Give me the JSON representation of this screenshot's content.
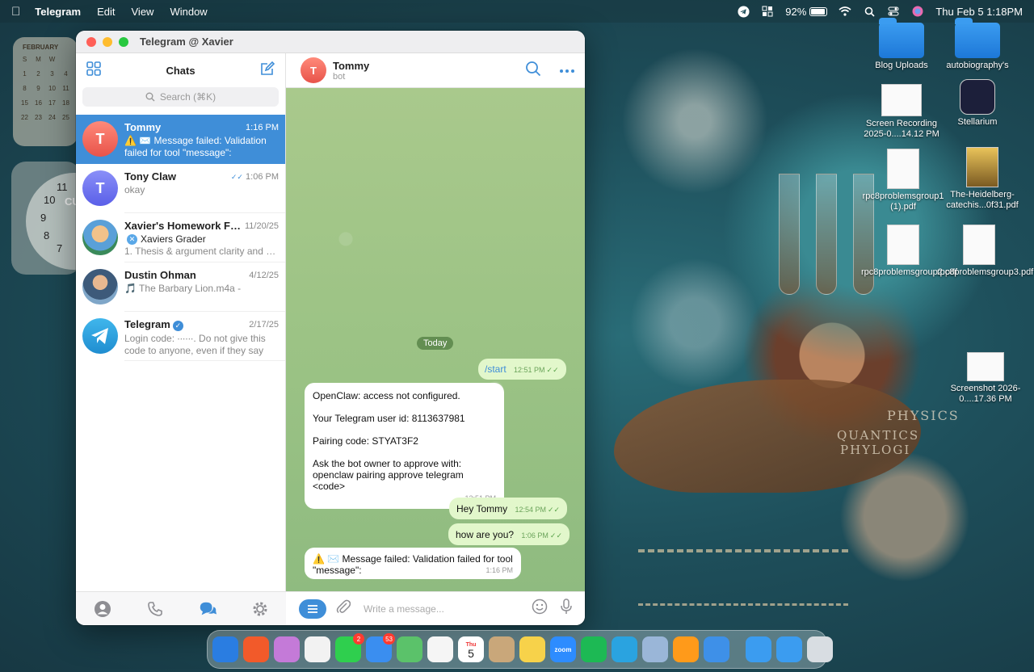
{
  "menubar": {
    "app_name": "Telegram",
    "items": [
      "Edit",
      "View",
      "Window"
    ],
    "battery": "92%",
    "datetime": "Thu Feb 5  1:18PM"
  },
  "calendar_widget": {
    "month": "FEBRUARY",
    "days": [
      "S",
      "M",
      "W",
      "",
      "1",
      "2",
      "3",
      "4",
      "8",
      "9",
      "10",
      "11",
      "15",
      "16",
      "17",
      "18",
      "22",
      "23",
      "24",
      "25"
    ]
  },
  "clock_widget": {
    "numbers": [
      "11",
      "10",
      "9",
      "8",
      "7",
      "6"
    ],
    "label": "CU"
  },
  "desktop": {
    "words": [
      "PHYSICS",
      "QUANTICS",
      "PHYLOGI"
    ],
    "icons": [
      {
        "label": "Blog Uploads",
        "type": "folder"
      },
      {
        "label": "autobiography's",
        "type": "folder"
      },
      {
        "label": "Screen Recording 2025-0....14.12 PM",
        "type": "doc"
      },
      {
        "label": "Stellarium",
        "type": "dark"
      },
      {
        "label": "rpc8problemsgroup1 (1).pdf",
        "type": "doc"
      },
      {
        "label": "The-Heidelberg-catechis...0f31.pdf",
        "type": "book"
      },
      {
        "label": "rpc8problemsgroup2.pdf",
        "type": "doc"
      },
      {
        "label": "rpc8problemsgroup3.pdf",
        "type": "doc"
      },
      {
        "label": "Screenshot 2026-0....17.36 PM",
        "type": "doc"
      }
    ]
  },
  "dock": {
    "apps": [
      {
        "name": "Finder",
        "color": "#2a7de1",
        "badge": ""
      },
      {
        "name": "Brave",
        "color": "#f25a2a",
        "badge": ""
      },
      {
        "name": "Launchpad",
        "color": "#c47ad8",
        "badge": ""
      },
      {
        "name": "ChatGPT",
        "color": "#f2f2f2",
        "badge": ""
      },
      {
        "name": "Messages",
        "color": "#2fcf4e",
        "badge": "2"
      },
      {
        "name": "Mail",
        "color": "#3a8ef0",
        "badge": "53"
      },
      {
        "name": "Maps",
        "color": "#5bc26a",
        "badge": ""
      },
      {
        "name": "Photos",
        "color": "#f5f5f5",
        "badge": ""
      },
      {
        "name": "Calendar",
        "color": "#ffffff",
        "badge": ""
      },
      {
        "name": "Contacts",
        "color": "#c9a77a",
        "badge": ""
      },
      {
        "name": "Notes",
        "color": "#f7d24a",
        "badge": ""
      },
      {
        "name": "Zoom",
        "color": "#2d8cff",
        "badge": ""
      },
      {
        "name": "Spotify",
        "color": "#1db954",
        "badge": ""
      },
      {
        "name": "Telegram",
        "color": "#2aa3e0",
        "badge": ""
      },
      {
        "name": "Finder Helper",
        "color": "#9ab6d8",
        "badge": ""
      },
      {
        "name": "Books",
        "color": "#ff9a1a",
        "badge": ""
      },
      {
        "name": "QuickTime",
        "color": "#3e90e8",
        "badge": ""
      }
    ],
    "trailing": [
      {
        "name": "Applications",
        "color": "#3b9cf0"
      },
      {
        "name": "Downloads",
        "color": "#3b9cf0"
      },
      {
        "name": "Trash",
        "color": "#d8dde2"
      }
    ],
    "calendar_day": "5",
    "calendar_month": "Thu",
    "zoom_label": "zoom"
  },
  "window": {
    "title": "Telegram @ Xavier",
    "sidebar": {
      "title": "Chats",
      "search_placeholder": "Search (⌘K)",
      "chats": [
        {
          "name": "Tommy",
          "time": "1:16 PM",
          "initial": "T",
          "avatar_color": "#ea5a4c",
          "preview": "⚠️ ✉️ Message failed: Validation failed for tool \"message\":",
          "sender": "",
          "active": true
        },
        {
          "name": "Tony Claw",
          "time": "1:06 PM",
          "initial": "T",
          "avatar_color": "#6a6ff0",
          "preview": "okay",
          "sender": "",
          "active": false
        },
        {
          "name": "Xavier's Homework Fee...",
          "time": "11/20/25",
          "initial": "",
          "avatar_color": "#e0a16a",
          "preview": "1. Thesis & argument clarity and su...",
          "sender": "Xaviers Grader",
          "active": false
        },
        {
          "name": "Dustin Ohman",
          "time": "4/12/25",
          "initial": "",
          "avatar_color": "#6e8bb0",
          "preview": "🎵 The Barbary Lion.m4a -",
          "sender": "",
          "active": false
        },
        {
          "name": "Telegram",
          "time": "2/17/25",
          "initial": "",
          "avatar_color": "#2aa3e0",
          "preview": "Login code: ∙∙∙∙∙∙. Do not give this code to anyone, even if they say th...",
          "sender": "",
          "active": false
        }
      ]
    },
    "chat": {
      "name": "Tommy",
      "status": "bot",
      "initial": "T",
      "date_label": "Today",
      "messages": [
        {
          "dir": "out",
          "text": "/start",
          "time": "12:51 PM"
        },
        {
          "dir": "in",
          "lines": [
            "OpenClaw: access not configured.",
            "",
            "Your Telegram user id: 8113637981",
            "",
            "Pairing code: STYAT3F2",
            "",
            "Ask the bot owner to approve with:",
            "openclaw pairing approve telegram <code>"
          ],
          "time": "12:51 PM"
        },
        {
          "dir": "out",
          "text": "Hey Tommy",
          "time": "12:54 PM"
        },
        {
          "dir": "out",
          "text": "how are you?",
          "time": "1:06 PM"
        },
        {
          "dir": "in",
          "lines": [
            "⚠️ ✉️ Message failed: Validation failed for tool",
            "\"message\":"
          ],
          "time": "1:16 PM"
        }
      ],
      "composer_placeholder": "Write a message..."
    }
  }
}
